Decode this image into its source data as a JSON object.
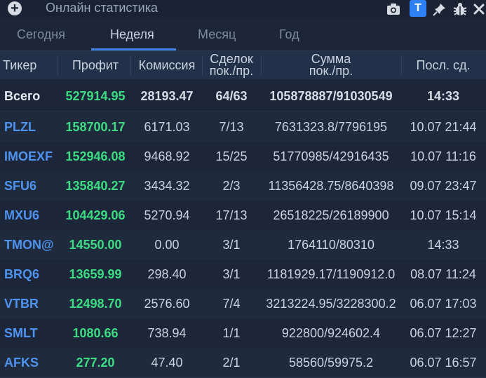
{
  "window": {
    "title": "Онлайн статистика",
    "badge": "T",
    "icons": [
      "add-icon",
      "camera-icon",
      "pin-icon",
      "bug-icon",
      "close-icon"
    ]
  },
  "tabs": [
    {
      "label": "Сегодня",
      "active": false
    },
    {
      "label": "Неделя",
      "active": true
    },
    {
      "label": "Месяц",
      "active": false
    },
    {
      "label": "Год",
      "active": false
    }
  ],
  "columns": {
    "ticker": "Тикер",
    "profit": "Профит",
    "commission": "Комиссия",
    "deals_1": "Сделок",
    "deals_2": "пок./пр.",
    "sum_1": "Сумма",
    "sum_2": "пок./пр.",
    "last": "Посл. сд."
  },
  "total": {
    "ticker": "Всего",
    "profit": "527914.95",
    "commission": "28193.47",
    "deals": "64/63",
    "sum": "105878887/91030549",
    "last": "14:33"
  },
  "rows": [
    {
      "ticker": "PLZL",
      "profit": "158700.17",
      "commission": "6171.03",
      "deals": "7/13",
      "sum": "7631323.8/7796195",
      "last": "10.07 21:44"
    },
    {
      "ticker": "IMOEXF",
      "profit": "152946.08",
      "commission": "9468.92",
      "deals": "15/25",
      "sum": "51770985/42916435",
      "last": "10.07 11:16"
    },
    {
      "ticker": "SFU6",
      "profit": "135840.27",
      "commission": "3434.32",
      "deals": "2/3",
      "sum": "11356428.75/8640398",
      "last": "09.07 23:47"
    },
    {
      "ticker": "MXU6",
      "profit": "104429.06",
      "commission": "5270.94",
      "deals": "17/13",
      "sum": "26518225/26189900",
      "last": "10.07 15:14"
    },
    {
      "ticker": "TMON@",
      "profit": "14550.00",
      "commission": "0.00",
      "deals": "3/1",
      "sum": "1764110/80310",
      "last": "14:33"
    },
    {
      "ticker": "BRQ6",
      "profit": "13659.99",
      "commission": "298.40",
      "deals": "3/1",
      "sum": "1181929.17/1190912.0",
      "last": "08.07 11:24"
    },
    {
      "ticker": "VTBR",
      "profit": "12498.70",
      "commission": "2576.60",
      "deals": "7/4",
      "sum": "3213224.95/3228300.2",
      "last": "06.07 17:03"
    },
    {
      "ticker": "SMLT",
      "profit": "1080.66",
      "commission": "738.94",
      "deals": "1/1",
      "sum": "922800/924602.4",
      "last": "06.07 12:27"
    },
    {
      "ticker": "AFKS",
      "profit": "277.20",
      "commission": "47.40",
      "deals": "2/1",
      "sum": "58560/59975.2",
      "last": "06.07 16:57"
    }
  ]
}
